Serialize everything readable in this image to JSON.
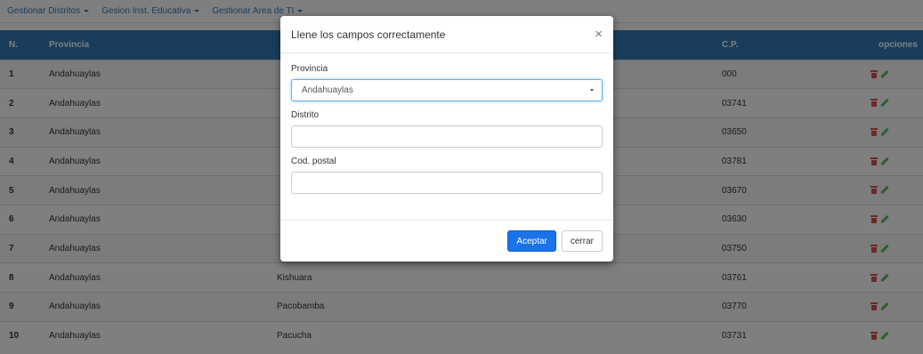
{
  "nav": {
    "items": [
      "Gestionar Distritos",
      "Gesion Inst. Educativa",
      "Gestionar Area de TI"
    ]
  },
  "table": {
    "headers": [
      "N.",
      "Provincia",
      "",
      "C.P.",
      "opciones"
    ],
    "rows": [
      {
        "n": "1",
        "provincia": "Andahuaylas",
        "distrito": "",
        "cp": "000"
      },
      {
        "n": "2",
        "provincia": "Andahuaylas",
        "distrito": "",
        "cp": "03741"
      },
      {
        "n": "3",
        "provincia": "Andahuaylas",
        "distrito": "",
        "cp": "03650"
      },
      {
        "n": "4",
        "provincia": "Andahuaylas",
        "distrito": "",
        "cp": "03781"
      },
      {
        "n": "5",
        "provincia": "Andahuaylas",
        "distrito": "",
        "cp": "03670"
      },
      {
        "n": "6",
        "provincia": "Andahuaylas",
        "distrito": "",
        "cp": "03630"
      },
      {
        "n": "7",
        "provincia": "Andahuaylas",
        "distrito": "",
        "cp": "03750"
      },
      {
        "n": "8",
        "provincia": "Andahuaylas",
        "distrito": "Kishuara",
        "cp": "03761"
      },
      {
        "n": "9",
        "provincia": "Andahuaylas",
        "distrito": "Pacobamba",
        "cp": "03770"
      },
      {
        "n": "10",
        "provincia": "Andahuaylas",
        "distrito": "Pacucha",
        "cp": "03731"
      }
    ]
  },
  "modal": {
    "title": "Llene los campos correctamente",
    "close_label": "×",
    "provincia_label": "Provincia",
    "provincia_value": "Andahuaylas",
    "distrito_label": "Distrito",
    "distrito_value": "",
    "codpostal_label": "Cod. postal",
    "codpostal_value": "",
    "accept_label": "Aceptar",
    "close_button_label": "cerrar"
  },
  "colors": {
    "header_bg": "#337ab7",
    "primary_button": "#1a73e8",
    "delete_icon": "#d9534f",
    "edit_icon": "#5cb85c"
  },
  "icons": [
    "caret-down-icon",
    "trash-icon",
    "pencil-icon",
    "close-icon",
    "select-arrow-icon"
  ]
}
